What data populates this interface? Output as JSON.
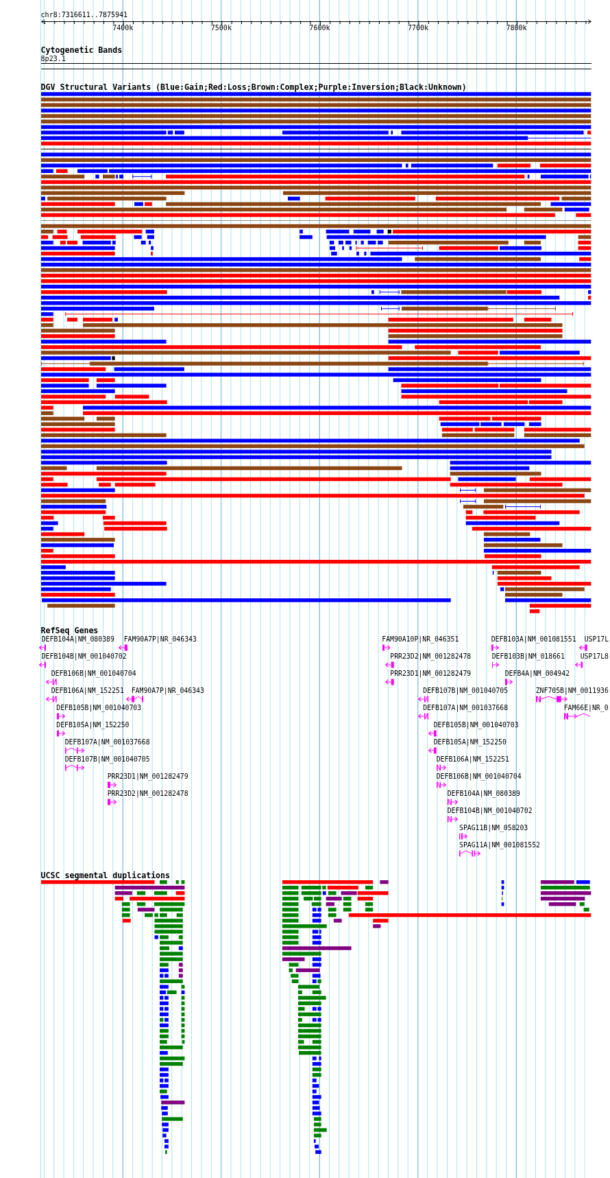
{
  "ruler": {
    "location": "chr8:7316611..7875941",
    "ticks": [
      "7400k",
      "7500k",
      "7600k",
      "7700k",
      "7800k"
    ]
  },
  "tracks": [
    {
      "kind": "cytoband",
      "title": "Cytogenetic Bands",
      "band": "8p23.1"
    },
    {
      "kind": "variants",
      "title": "DGV Structural Variants (Blue:Gain;Red:Loss;Brown:Complex;Purple:Inversion;Black:Unknown)"
    },
    {
      "kind": "genes",
      "title": "RefSeq Genes",
      "genes": [
        {
          "label": "DEFB104A|NM_080389",
          "reverse": true
        },
        {
          "label": "FAM90A7P|NR_046343",
          "reverse": true
        },
        {
          "label": "FAM90A10P|NR_046351",
          "reverse": false
        },
        {
          "label": "DEFB103A|NM_001081551",
          "reverse": false
        },
        {
          "label": "USP17L",
          "reverse": true
        },
        {
          "label": "DEFB104B|NM_001040702",
          "reverse": true
        },
        {
          "label": "PRR23D2|NM_001282478",
          "reverse": true
        },
        {
          "label": "DEFB103B|NM_018661",
          "reverse": false
        },
        {
          "label": "USP17L8",
          "reverse": true
        },
        {
          "label": "DEFB106B|NM_001040704",
          "reverse": true
        },
        {
          "label": "PRR23D1|NM_001282479",
          "reverse": true
        },
        {
          "label": "DEFB4A|NM_004942",
          "reverse": false
        },
        {
          "label": "DEFB106A|NM_152251",
          "reverse": true
        },
        {
          "label": "FAM90A7P|NR_046343",
          "reverse": true
        },
        {
          "label": "DEFB107B|NM_001040705",
          "reverse": true
        },
        {
          "label": "ZNF705B|NM_0011936",
          "reverse": false
        },
        {
          "label": "DEFB105B|NM_001040703",
          "reverse": false
        },
        {
          "label": "DEFB107A|NM_001037668",
          "reverse": true
        },
        {
          "label": "FAM66E|NR_0",
          "reverse": false
        },
        {
          "label": "DEFB105A|NM_152250",
          "reverse": false
        },
        {
          "label": "DEFB105B|NM_001040703",
          "reverse": true
        },
        {
          "label": "DEFB107A|NM_001037668",
          "reverse": false
        },
        {
          "label": "DEFB105A|NM_152250",
          "reverse": true
        },
        {
          "label": "DEFB107B|NM_001040705",
          "reverse": false
        },
        {
          "label": "DEFB106A|NM_152251",
          "reverse": false
        },
        {
          "label": "PRR23D1|NM_001282479",
          "reverse": false
        },
        {
          "label": "DEFB106B|NM_001040704",
          "reverse": false
        },
        {
          "label": "PRR23D2|NM_001282478",
          "reverse": false
        },
        {
          "label": "DEFB104A|NM_080389",
          "reverse": false
        },
        {
          "label": "DEFB104B|NM_001040702",
          "reverse": false
        },
        {
          "label": "SPAG11B|NM_058203",
          "reverse": false
        },
        {
          "label": "SPAG11A|NM_001081552",
          "reverse": false
        }
      ]
    },
    {
      "kind": "duplications",
      "title": "UCSC segmental duplications"
    }
  ]
}
